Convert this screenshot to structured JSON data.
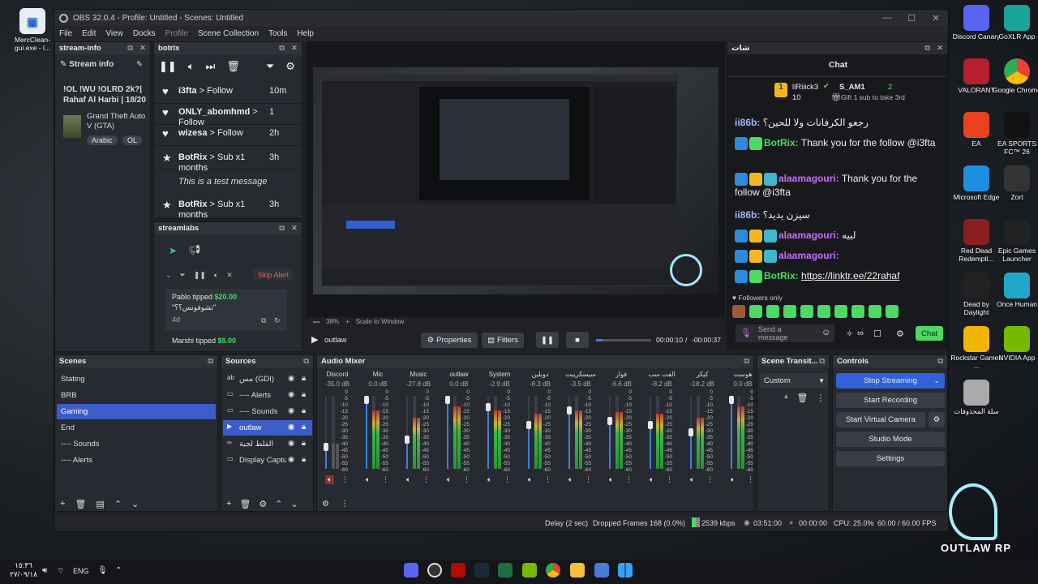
{
  "window": {
    "title": "OBS 32.0.4 - Profile: Untitled - Scenes: Untitled"
  },
  "menu": [
    "File",
    "Edit",
    "View",
    "Docks",
    "Profile",
    "Scene Collection",
    "Tools",
    "Help"
  ],
  "stream_info": {
    "header": "stream-info",
    "title_label": "Stream info",
    "stream_title": "!OL !WU !OLRD 2k?| Rahaf Al Harbi | 18/20",
    "game": "Grand Theft Auto V (GTA)",
    "tags": [
      "Arabic",
      "OL"
    ]
  },
  "botrix": {
    "header": "botrix",
    "events": [
      {
        "name": "i3fta",
        "action": "Follow",
        "time": "10m",
        "type": "heart"
      },
      {
        "name": "ONLY_abomhmd",
        "action": "Follow",
        "time": "1",
        "type": "heart"
      },
      {
        "name": "wizesa",
        "action": "Follow",
        "time": "2h",
        "type": "heart"
      },
      {
        "name": "BotRix",
        "action": "Sub x1 months",
        "time": "3h",
        "type": "star",
        "message": "This is a test message"
      },
      {
        "name": "BotRix",
        "action": "Sub x1 months",
        "time": "3h",
        "type": "star"
      }
    ]
  },
  "streamlabs": {
    "header": "streamlabs",
    "skip_label": "Skip Alert",
    "alerts": [
      {
        "text_prefix": "Pablo tipped ",
        "amount": "$20.00",
        "message": "\"تشوفونس؟؟\"",
        "age": "4d"
      },
      {
        "text_prefix": "Marshi tipped ",
        "amount": "$5.00"
      }
    ]
  },
  "preview": {
    "zoom": "38%",
    "scale_mode": "Scale to Window",
    "watermark": "OUTLAW RP"
  },
  "transport": {
    "source_name": "outlaw",
    "properties_label": "Properties",
    "filters_label": "Filters",
    "time_elapsed": "00:00:10",
    "time_sep": "/",
    "time_remaining": "-00:00:37",
    "progress": 0.12
  },
  "chat": {
    "panel_header": "شات",
    "title": "Chat",
    "leaderboard": {
      "first_name": "llRiiick3",
      "first_count": "10",
      "second_name": "S_AM1",
      "second_count": "2",
      "gift_text": "Gift 1 sub to take 3rd"
    },
    "messages": [
      {
        "user": "ii86b:",
        "text": "رجعو الكرفانات ولا للحين؟",
        "color": "#9fb6ff",
        "badges": []
      },
      {
        "user": "BotRix:",
        "text": "Thank you for the follow @i3fta",
        "color": "#4cd964",
        "badges": [
          "tool",
          "verified"
        ]
      },
      {
        "user": "alaamagouri:",
        "text": "Thank you for the follow @i3fta",
        "color": "#c86dff",
        "badges": [
          "tool",
          "crown",
          "sub"
        ]
      },
      {
        "user": "ii86b:",
        "text": "سيزن يديد؟",
        "color": "#9fb6ff",
        "badges": []
      },
      {
        "user": "alaamagouri:",
        "text": "لبيه",
        "color": "#c86dff",
        "badges": [
          "tool",
          "crown",
          "sub"
        ]
      },
      {
        "user": "alaamagouri:",
        "text": "",
        "color": "#c86dff",
        "badges": [
          "tool",
          "crown",
          "sub"
        ]
      },
      {
        "user": "BotRix:",
        "text": "https://linktr.ee/22rahaf",
        "color": "#4cd964",
        "badges": [
          "tool",
          "verified"
        ]
      }
    ],
    "followers_only": "Followers only",
    "input_placeholder": "Send a message",
    "send_label": "Chat"
  },
  "scenes": {
    "header": "Scenes",
    "items": [
      "Stating",
      "BRB",
      "Gaming",
      "End",
      "---- Sounds",
      "---- Alerts"
    ],
    "selected": 2
  },
  "sources": {
    "header": "Sources",
    "items": [
      "مس (GDI)",
      "---- Alerts",
      "---- Sounds",
      "outlaw",
      "القلط لجية",
      "Display Captu"
    ],
    "selected": 3
  },
  "mixer": {
    "header": "Audio Mixer",
    "channels": [
      {
        "name": "Discord",
        "db": "-35.0 dB",
        "level": 0.35,
        "fader": 0.3,
        "muted": true
      },
      {
        "name": "Mic",
        "db": "0.0 dB",
        "level": 0.8,
        "fader": 0.95,
        "muted": false
      },
      {
        "name": "Music",
        "db": "-27.8 dB",
        "level": 0.7,
        "fader": 0.4,
        "muted": false
      },
      {
        "name": "outlaw",
        "db": "0.0 dB",
        "level": 0.85,
        "fader": 0.95,
        "muted": false
      },
      {
        "name": "System",
        "db": "-2.9 dB",
        "level": 0.8,
        "fader": 0.85,
        "muted": false
      },
      {
        "name": "دوبلين",
        "db": "-8.3 dB",
        "level": 0.75,
        "fader": 0.6,
        "muted": false
      },
      {
        "name": "سيسكريبت",
        "db": "-3.5 dB",
        "level": 0.8,
        "fader": 0.8,
        "muted": false
      },
      {
        "name": "فواز",
        "db": "-6.6 dB",
        "level": 0.78,
        "fader": 0.65,
        "muted": false
      },
      {
        "name": "الفت سب",
        "db": "-8.2 dB",
        "level": 0.76,
        "fader": 0.6,
        "muted": false
      },
      {
        "name": "كيكر",
        "db": "-18.2 dB",
        "level": 0.7,
        "fader": 0.5,
        "muted": false
      },
      {
        "name": "هوست",
        "db": "0.0 dB",
        "level": 0.85,
        "fader": 0.95,
        "muted": false
      }
    ],
    "scale": [
      "0",
      "-5",
      "-10",
      "-15",
      "-20",
      "-25",
      "-30",
      "-35",
      "-40",
      "-45",
      "-50",
      "-55",
      "-60"
    ]
  },
  "transitions": {
    "header": "Scene Transit...",
    "selected": "Custom"
  },
  "controls": {
    "header": "Controls",
    "stop_streaming": "Stop Streaming",
    "start_recording": "Start Recording",
    "start_virtual_camera": "Start Virtual Camera",
    "studio_mode": "Studio Mode",
    "settings": "Settings"
  },
  "status_bar": {
    "delay": "Delay (2 sec)",
    "dropped": "Dropped Frames 168 (0.0%)",
    "bitrate": "2539 kbps",
    "stream_time": "03:51:00",
    "rec_time": "00:00:00",
    "cpu": "CPU: 25.0%",
    "fps": "60.00 / 60.00 FPS"
  },
  "desktop": {
    "left_icon": "MercClean-gui.exe - l...",
    "icons_col1": [
      "Discord Canary",
      "VALORANT",
      "EA",
      "Microsoft Edge",
      "Red Dead Redempti...",
      "Dead by Daylight",
      "Rockstar Games ...",
      "سلة المحذوفات"
    ],
    "icons_col2": [
      "GoXLR App",
      "Google Chrome",
      "EA SPORTS FC™ 26",
      "Zort",
      "Epic Games Launcher",
      "Once Human",
      "NVIDIA App"
    ],
    "watermark": "OUTLAW RP"
  },
  "taskbar": {
    "time": "١٥:٣٦",
    "date": "٢٧/٠٩/١٨",
    "lang": "ENG"
  }
}
